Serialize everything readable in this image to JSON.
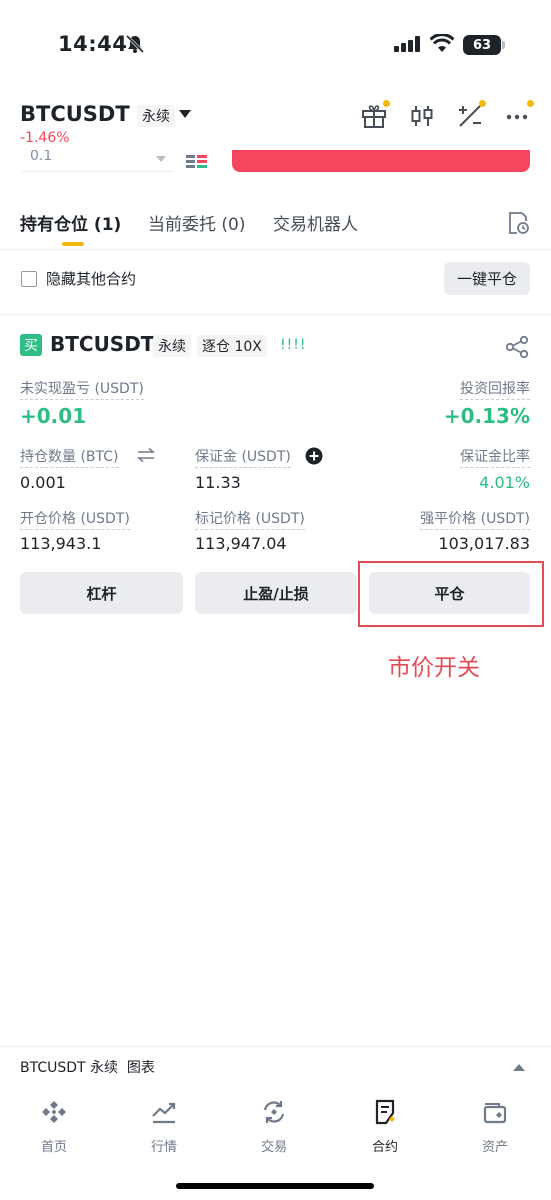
{
  "status": {
    "time": "14:44",
    "battery": "63"
  },
  "header": {
    "symbol": "BTCUSDT",
    "tag": "永续",
    "change": "-1.46%",
    "icons": [
      "gift-icon",
      "candlestick-icon",
      "calculator-icon",
      "more-icon"
    ]
  },
  "strip": {
    "quantity": "0.1"
  },
  "tabs": [
    {
      "label": "持有仓位 (1)",
      "active": true
    },
    {
      "label": "当前委托 (0)",
      "active": false
    },
    {
      "label": "交易机器人",
      "active": false
    }
  ],
  "filter": {
    "hide_label": "隐藏其他合约",
    "close_all": "一键平仓"
  },
  "position": {
    "side": "买",
    "symbol": "BTCUSDT",
    "type": "永续",
    "mode": "逐仓 10X",
    "unrealized_label": "未实现盈亏 (USDT)",
    "unrealized_value": "+0.01",
    "roi_label": "投资回报率",
    "roi_value": "+0.13%",
    "size_label": "持仓数量 (BTC)",
    "size_value": "0.001",
    "margin_label": "保证金 (USDT)",
    "margin_value": "11.33",
    "margin_ratio_label": "保证金比率",
    "margin_ratio_value": "4.01%",
    "entry_label": "开仓价格 (USDT)",
    "entry_value": "113,943.1",
    "mark_label": "标记价格 (USDT)",
    "mark_value": "113,947.04",
    "liq_label": "强平价格 (USDT)",
    "liq_value": "103,017.83",
    "buttons": {
      "leverage": "杠杆",
      "tpsl": "止盈/止损",
      "close": "平仓"
    }
  },
  "annotation": "市价开关",
  "chart_bar": {
    "label": "BTCUSDT 永续  图表"
  },
  "nav": [
    {
      "label": "首页",
      "icon": "home-icon",
      "active": false
    },
    {
      "label": "行情",
      "icon": "markets-icon",
      "active": false
    },
    {
      "label": "交易",
      "icon": "trade-icon",
      "active": false
    },
    {
      "label": "合约",
      "icon": "futures-icon",
      "active": true
    },
    {
      "label": "资产",
      "icon": "wallet-icon",
      "active": false
    }
  ],
  "colors": {
    "accent": "#f0b90b",
    "up": "#2ebd85",
    "down": "#f6465d",
    "annotation": "#e34d55"
  }
}
